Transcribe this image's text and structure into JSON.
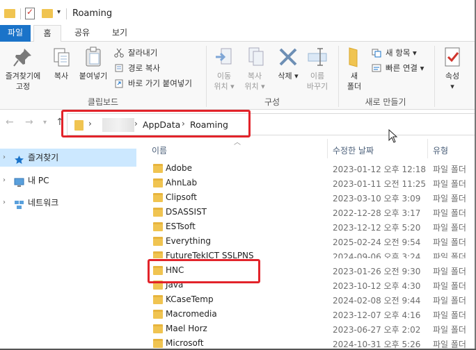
{
  "window": {
    "title": "Roaming"
  },
  "tabs": {
    "file": "파일",
    "home": "홈",
    "share": "공유",
    "view": "보기"
  },
  "ribbon": {
    "pin_label_1": "즐겨찾기에",
    "pin_label_2": "고정",
    "copy_label": "복사",
    "paste_label": "붙여넣기",
    "cut_label": "잘라내기",
    "copy_path_label": "경로 복사",
    "paste_shortcut_label": "바로 가기 붙여넣기",
    "clipboard_group": "클립보드",
    "move_to_1": "이동",
    "move_to_2": "위치",
    "copy_to_1": "복사",
    "copy_to_2": "위치",
    "delete_label": "삭제",
    "rename_1": "이름",
    "rename_2": "바꾸기",
    "organize_group": "구성",
    "new_folder_1": "새",
    "new_folder_2": "폴더",
    "new_item_label": "새 항목",
    "easy_access_label": "빠른 연결",
    "new_group": "새로 만들기",
    "properties_label": "속성"
  },
  "address": {
    "crumbs": [
      "AppData",
      "Roaming"
    ]
  },
  "nav": {
    "items": [
      {
        "label": "즐겨찾기"
      },
      {
        "label": "내 PC"
      },
      {
        "label": "네트워크"
      }
    ]
  },
  "columns": {
    "name": "이름",
    "date": "수정한 날짜",
    "type": "유형"
  },
  "files": [
    {
      "name": "Adobe",
      "date": "2023-01-12 오후 12:18",
      "type": "파일 폴더"
    },
    {
      "name": "AhnLab",
      "date": "2023-01-11 오전 11:25",
      "type": "파일 폴더"
    },
    {
      "name": "Clipsoft",
      "date": "2023-03-10 오후 3:09",
      "type": "파일 폴더"
    },
    {
      "name": "DSASSIST",
      "date": "2022-12-28 오후 3:17",
      "type": "파일 폴더"
    },
    {
      "name": "ESTsoft",
      "date": "2023-12-12 오후 5:20",
      "type": "파일 폴더"
    },
    {
      "name": "Everything",
      "date": "2025-02-24 오전 9:54",
      "type": "파일 폴더"
    },
    {
      "name": "FutureTekICT SSLPNS",
      "date": "2024-09-06 오후 3:24",
      "type": "파일 폴더"
    },
    {
      "name": "HNC",
      "date": "2023-01-26 오전 9:30",
      "type": "파일 폴더"
    },
    {
      "name": "Java",
      "date": "2023-10-12 오후 4:30",
      "type": "파일 폴더"
    },
    {
      "name": "KCaseTemp",
      "date": "2024-02-08 오전 9:44",
      "type": "파일 폴더"
    },
    {
      "name": "Macromedia",
      "date": "2023-12-07 오후 4:16",
      "type": "파일 폴더"
    },
    {
      "name": "Mael Horz",
      "date": "2023-06-27 오후 2:02",
      "type": "파일 폴더"
    },
    {
      "name": "Microsoft",
      "date": "2024-10-31 오후 5:26",
      "type": "파일 폴더"
    }
  ]
}
